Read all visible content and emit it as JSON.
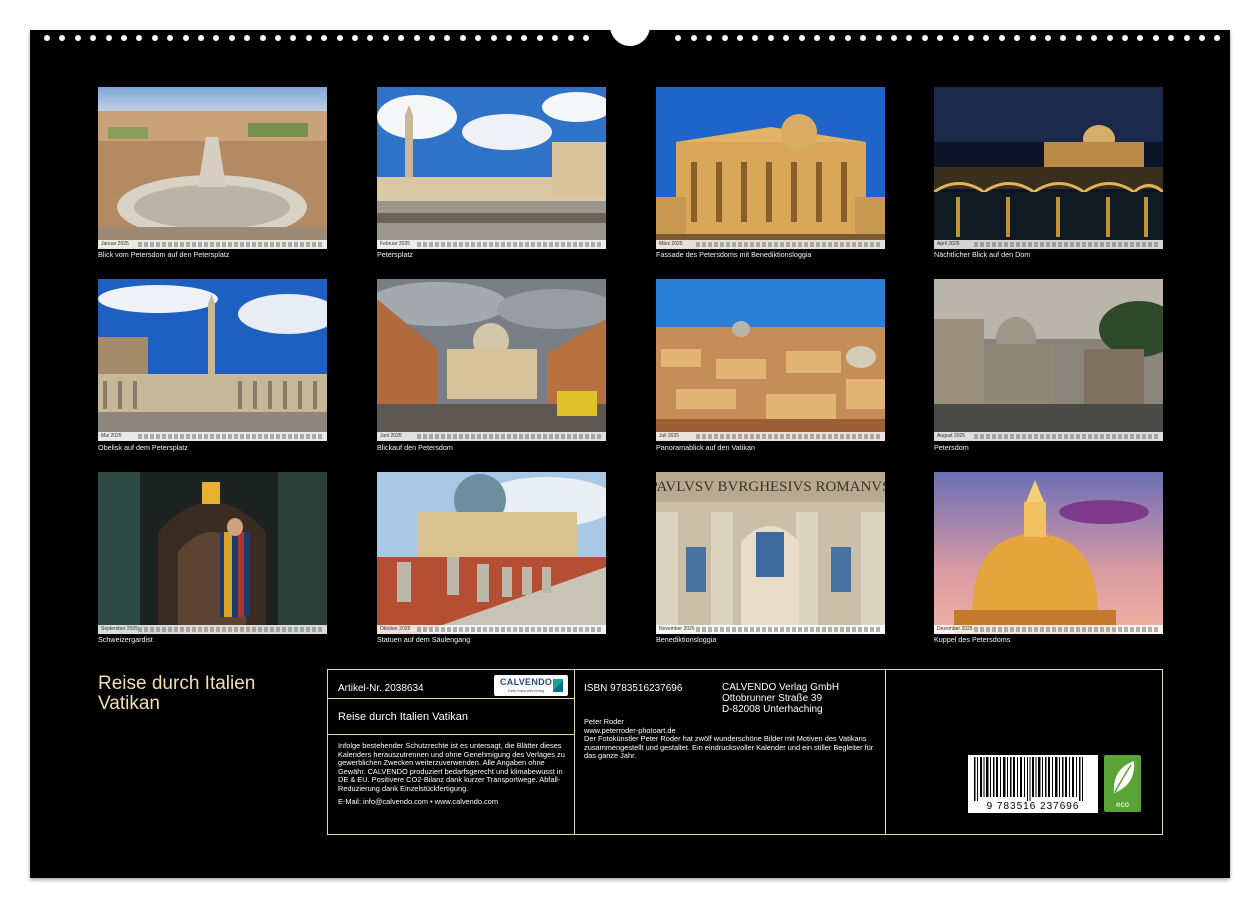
{
  "photos": [
    {
      "caption": "Blick vom Petersdom auf den Petersplatz",
      "month": "Januar 2025"
    },
    {
      "caption": "Petersplatz",
      "month": "Februar 2025"
    },
    {
      "caption": "Fassade des Petersdoms mit Benediktionsloggia",
      "month": "März 2025"
    },
    {
      "caption": "Nächtlicher Blick auf den Dom",
      "month": "April 2025"
    },
    {
      "caption": "Obelisk auf dem Petersplatz",
      "month": "Mai 2025"
    },
    {
      "caption": "Blickauf den Petersdom",
      "month": "Juni 2025"
    },
    {
      "caption": "Panoramablick auf den Vatikan",
      "month": "Juli 2025"
    },
    {
      "caption": "Petersdom",
      "month": "August 2025"
    },
    {
      "caption": "Schweizergardist",
      "month": "September 2025"
    },
    {
      "caption": "Statuen auf dem Säulengang",
      "month": "Oktober 2025"
    },
    {
      "caption": "Benediktionsloggia",
      "month": "November 2025"
    },
    {
      "caption": "Kuppel des Petersdoms",
      "month": "Dezember 2025"
    }
  ],
  "inscription": "PAVLVSV BVRGHESIVS ROMANVS",
  "cover": {
    "title_line1": "Reise durch Italien",
    "title_line2": "Vatikan"
  },
  "info": {
    "article": "Artikel-Nr. 2038634",
    "product_title": "Reise durch Italien Vatikan",
    "legal": "Infolge bestehender Schutzrechte ist es untersagt, die Blätter dieses Kalenders herauszutrennen und ohne Genehmigung des Verlages zu gewerblichen Zwecken weiterzuverwenden. Alle Angaben ohne Gewähr. CALVENDO produziert bedarfsgerecht und klimabewusst in DE & EU. Positivere CO2-Bilanz dank kurzer Transportwege. Abfall-Reduzierung dank Einzelstückfertigung.",
    "contact": "E-Mail: info@calvendo.com • www.calvendo.com",
    "isbn": "ISBN 9783516237696",
    "publisher_line1": "CALVENDO Verlag GmbH",
    "publisher_line2": "Ottobrunner Straße 39",
    "publisher_line3": "D-82008 Unterhaching",
    "author": "Peter Roder",
    "website": "www.peterroder-photoart.de",
    "description": "Der Fotokünstler Peter Roder hat zwölf wunderschöne Bilder mit Motiven des Vatikans zusammengestellt und gestaltet. Ein eindrucksvoller Kalender und ein stiller Begleiter für das ganze Jahr.",
    "barcode_number": "9 783516 237696",
    "logo_word": "CALVENDO",
    "logo_tagline": "Dein Kalenderverlag",
    "eco_label": "eco"
  },
  "colors": {
    "background": "#000000",
    "title": "#f1dfb0",
    "border": "#e6d7a8",
    "eco": "#5aa437"
  }
}
